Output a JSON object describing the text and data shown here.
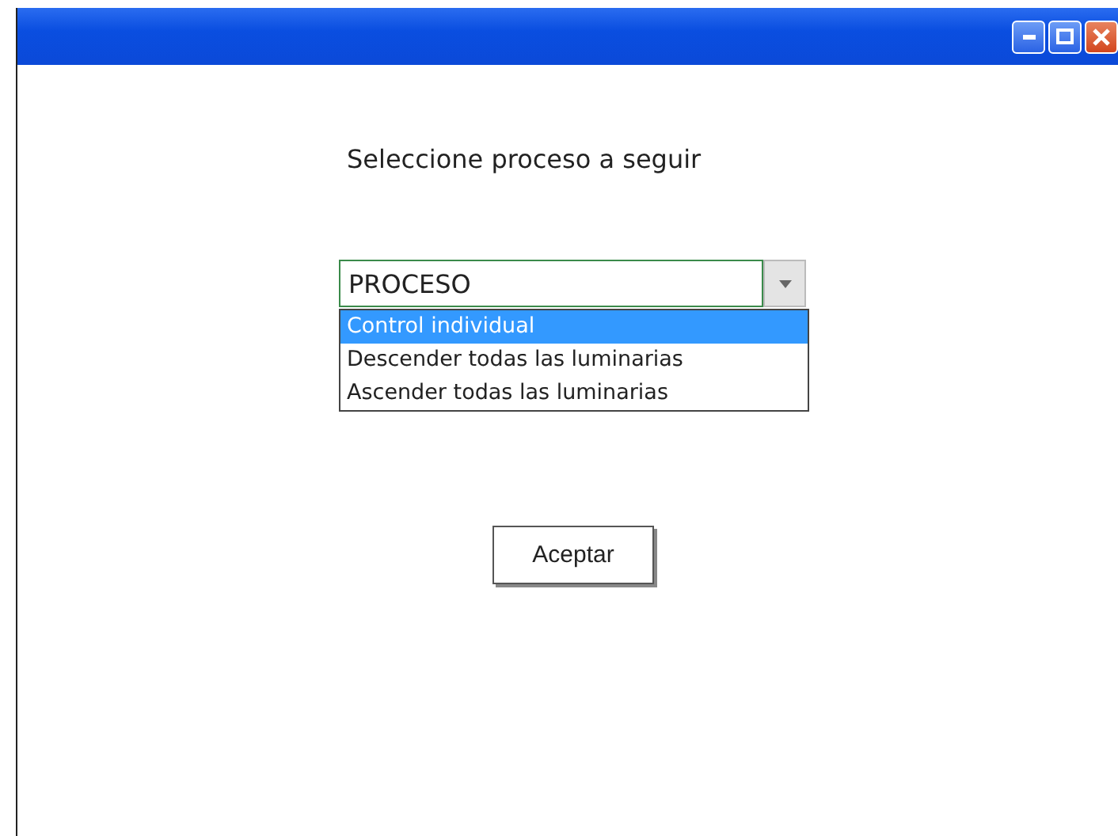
{
  "window": {
    "controls": [
      {
        "kind": "minimize"
      },
      {
        "kind": "maximize"
      },
      {
        "kind": "close"
      }
    ]
  },
  "prompt": "Seleccione proceso a seguir",
  "combo": {
    "value": "PROCESO",
    "expanded": true,
    "options": [
      {
        "label": "Control individual",
        "selected": true
      },
      {
        "label": "Descender todas las luminarias",
        "selected": false
      },
      {
        "label": "Ascender todas las luminarias",
        "selected": false
      }
    ]
  },
  "button": "Aceptar"
}
